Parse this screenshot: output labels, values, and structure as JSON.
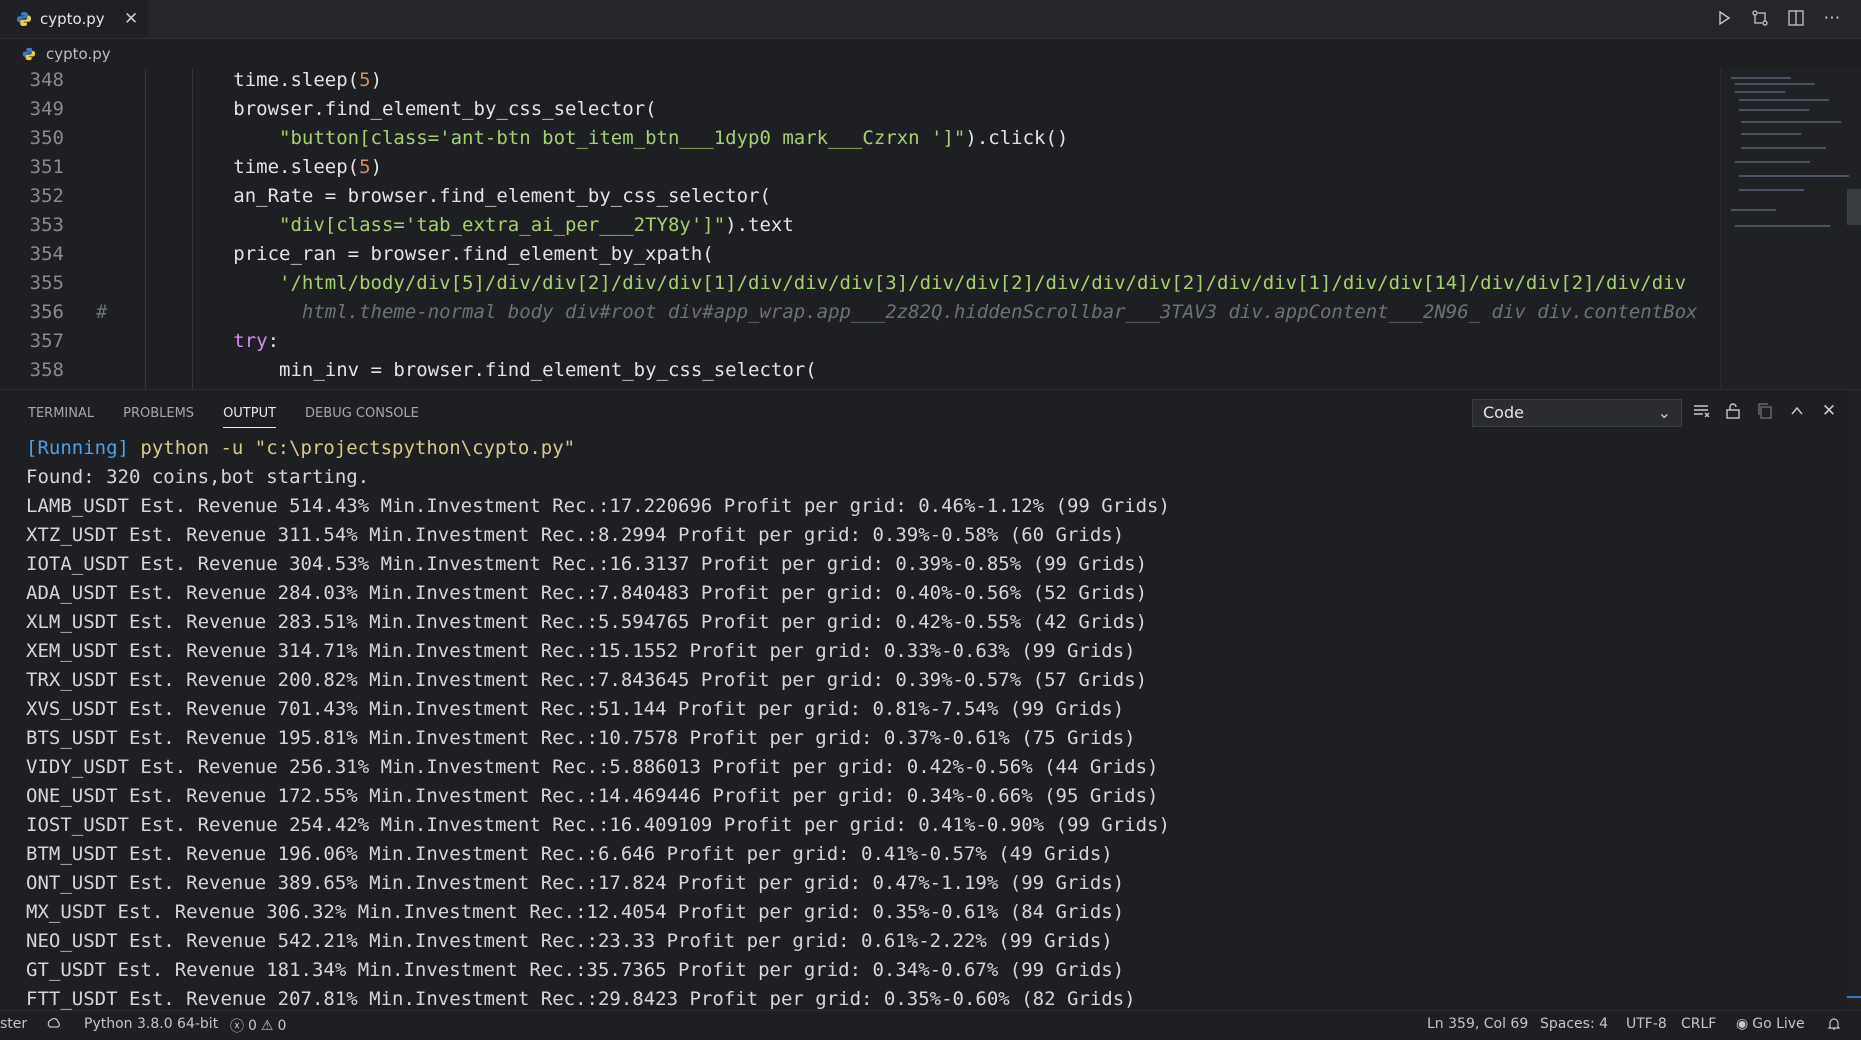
{
  "tab": {
    "title": "cypto.py",
    "close": "✕"
  },
  "breadcrumb": {
    "file": "cypto.py"
  },
  "editor": {
    "lines": [
      {
        "n": "348",
        "indent": "            ",
        "parts": [
          [
            "time.sleep(",
            "p"
          ],
          [
            "5",
            "num"
          ],
          [
            ")",
            "p"
          ]
        ]
      },
      {
        "n": "349",
        "indent": "            ",
        "parts": [
          [
            "browser.find_element_by_css_selector(",
            "p"
          ]
        ]
      },
      {
        "n": "350",
        "indent": "                ",
        "parts": [
          [
            "\"button[class='ant-btn bot_item_btn___1dyp0 mark___Czrxn ']\"",
            "str"
          ],
          [
            ").click()",
            "p"
          ]
        ]
      },
      {
        "n": "351",
        "indent": "            ",
        "parts": [
          [
            "time.sleep(",
            "p"
          ],
          [
            "5",
            "num"
          ],
          [
            ")",
            "p"
          ]
        ]
      },
      {
        "n": "352",
        "indent": "            ",
        "parts": [
          [
            "an_Rate = browser.find_element_by_css_selector(",
            "p"
          ]
        ]
      },
      {
        "n": "353",
        "indent": "                ",
        "parts": [
          [
            "\"div[class='tab_extra_ai_per___2TY8y']\"",
            "str"
          ],
          [
            ").text",
            "p"
          ]
        ]
      },
      {
        "n": "354",
        "indent": "            ",
        "parts": [
          [
            "price_ran = browser.find_element_by_xpath(",
            "p"
          ]
        ]
      },
      {
        "n": "355",
        "indent": "                ",
        "parts": [
          [
            "'/html/body/div[5]/div/div[2]/div/div[1]/div/div/div[3]/div/div[2]/div/div/div[2]/div/div[1]/div/div[14]/div/div[2]/div/div",
            "str"
          ]
        ]
      },
      {
        "n": "356",
        "indent": "",
        "parts": [
          [
            "#                 html.theme-normal body div#root div#app_wrap.app___2z82Q.hiddenScrollbar___3TAV3 div.appContent___2N96_ div div.contentBox",
            "cmt"
          ]
        ]
      },
      {
        "n": "357",
        "indent": "            ",
        "parts": [
          [
            "try",
            "kw"
          ],
          [
            ":",
            "p"
          ]
        ]
      },
      {
        "n": "358",
        "indent": "                ",
        "parts": [
          [
            "min_inv = browser.find_element_by_css_selector(",
            "p"
          ]
        ]
      }
    ]
  },
  "panel": {
    "tabs": [
      "TERMINAL",
      "PROBLEMS",
      "OUTPUT",
      "DEBUG CONSOLE"
    ],
    "active_tab": "OUTPUT",
    "select_value": "Code",
    "running_tag": "[Running]",
    "running_cmd": " python -u \"c:\\projectspython\\cypto.py\"",
    "output_lines": [
      "Found: 320 coins,bot starting.",
      "LAMB_USDT Est. Revenue 514.43% Min.Investment Rec.:17.220696 Profit per grid: 0.46%-1.12% (99 Grids)",
      "XTZ_USDT Est. Revenue 311.54% Min.Investment Rec.:8.2994 Profit per grid: 0.39%-0.58% (60 Grids)",
      "IOTA_USDT Est. Revenue 304.53% Min.Investment Rec.:16.3137 Profit per grid: 0.39%-0.85% (99 Grids)",
      "ADA_USDT Est. Revenue 284.03% Min.Investment Rec.:7.840483 Profit per grid: 0.40%-0.56% (52 Grids)",
      "XLM_USDT Est. Revenue 283.51% Min.Investment Rec.:5.594765 Profit per grid: 0.42%-0.55% (42 Grids)",
      "XEM_USDT Est. Revenue 314.71% Min.Investment Rec.:15.1552 Profit per grid: 0.33%-0.63% (99 Grids)",
      "TRX_USDT Est. Revenue 200.82% Min.Investment Rec.:7.843645 Profit per grid: 0.39%-0.57% (57 Grids)",
      "XVS_USDT Est. Revenue 701.43% Min.Investment Rec.:51.144 Profit per grid: 0.81%-7.54% (99 Grids)",
      "BTS_USDT Est. Revenue 195.81% Min.Investment Rec.:10.7578 Profit per grid: 0.37%-0.61% (75 Grids)",
      "VIDY_USDT Est. Revenue 256.31% Min.Investment Rec.:5.886013 Profit per grid: 0.42%-0.56% (44 Grids)",
      "ONE_USDT Est. Revenue 172.55% Min.Investment Rec.:14.469446 Profit per grid: 0.34%-0.66% (95 Grids)",
      "IOST_USDT Est. Revenue 254.42% Min.Investment Rec.:16.409109 Profit per grid: 0.41%-0.90% (99 Grids)",
      "BTM_USDT Est. Revenue 196.06% Min.Investment Rec.:6.646 Profit per grid: 0.41%-0.57% (49 Grids)",
      "ONT_USDT Est. Revenue 389.65% Min.Investment Rec.:17.824 Profit per grid: 0.47%-1.19% (99 Grids)",
      "MX_USDT Est. Revenue 306.32% Min.Investment Rec.:12.4054 Profit per grid: 0.35%-0.61% (84 Grids)",
      "NEO_USDT Est. Revenue 542.21% Min.Investment Rec.:23.33 Profit per grid: 0.61%-2.22% (99 Grids)",
      "GT_USDT Est. Revenue 181.34% Min.Investment Rec.:35.7365 Profit per grid: 0.34%-0.67% (99 Grids)",
      "FTT_USDT Est. Revenue 207.81% Min.Investment Rec.:29.8423 Profit per grid: 0.35%-0.60% (82 Grids)"
    ]
  },
  "status": {
    "branch": "ster",
    "interpreter": "Python 3.8.0 64-bit",
    "errors": "0",
    "warnings": "0",
    "position": "Ln 359, Col 69",
    "spaces": "Spaces: 4",
    "encoding": "UTF-8",
    "eol": "CRLF",
    "golive": "Go Live"
  },
  "colors": {
    "accent_blue": "#4fa1e4",
    "string_green": "#a6d16f",
    "number_orange": "#d68d5f",
    "keyword_pink": "#d98cf0"
  },
  "icons": [
    "python-file-icon",
    "run-icon",
    "compare-changes-icon",
    "split-editor-icon",
    "more-actions-icon",
    "clear-output-icon",
    "lock-scroll-icon",
    "copy-icon",
    "maximize-panel-icon",
    "close-panel-icon",
    "sync-icon",
    "error-icon",
    "warning-icon",
    "broadcast-icon",
    "bell-icon"
  ]
}
